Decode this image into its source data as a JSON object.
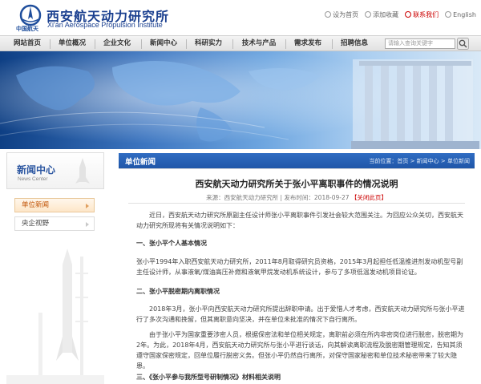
{
  "header": {
    "org_short": "中国航天",
    "title_cn": "西安航天动力研究所",
    "title_en": "Xi'an Aerospace Propulsion Institute",
    "links": [
      "设为首页",
      "添加收藏",
      "联系我们",
      "English"
    ]
  },
  "nav": {
    "items": [
      "网站首页",
      "单位概况",
      "企业文化",
      "新闻中心",
      "科研实力",
      "技术与产品",
      "需求发布",
      "招聘信息"
    ],
    "search_placeholder": "请输入查询关键字"
  },
  "sidebar": {
    "title": "新闻中心",
    "subtitle": "News Center",
    "items": [
      "单位新闻",
      "央企视野"
    ]
  },
  "main": {
    "section_title": "单位新闻",
    "breadcrumb": "当前位置：首页 > 新闻中心 > 单位新闻",
    "article": {
      "title": "西安航天动力研究所关于张小平离职事件的情况说明",
      "meta": "来源：西安航天动力研究所 | 发布时间：2018-09-27",
      "close_link": "【关闭此页】",
      "intro": "近日，西安航天动力研究所原副主任设计师张小平离职事件引发社会较大范围关注。为回应公众关切，西安航天动力研究所现将有关情况说明如下：",
      "h1": "一、张小平个人基本情况",
      "p1": "张小平1994年入职西安航天动力研究所，2011年8月取得研究员资格，2015年3月起担任低温推进剂发动机型号副主任设计师，从事液氧/煤油高压补燃和液氧甲烷发动机系统设计，参与了多项低温发动机项目论证。",
      "h2": "二、张小平脱密期内离职情况",
      "p2": "2018年3月，张小平向西安航天动力研究所提出辞职申请。出于爱惜人才考虑，西安航天动力研究所与张小平进行了多次沟通和挽留，但其离职意向坚决，并在单位未批准的情况下自行离所。",
      "p3": "由于张小平为国家重要涉密人员，根据保密法和单位相关规定，离职前必须在所内非密岗位进行脱密，脱密期为2年。为此，2018年4月，西安航天动力研究所与张小平进行谈话，向其解读离职流程及脱密期管理规定，告知其须遵守国家保密规定，回单位履行脱密义务。但张小平仍然自行离所，对保守国家秘密和单位技术秘密带来了较大隐患。",
      "h3": "三、《张小平参与我所型号研制情况》材料相关说明"
    }
  }
}
